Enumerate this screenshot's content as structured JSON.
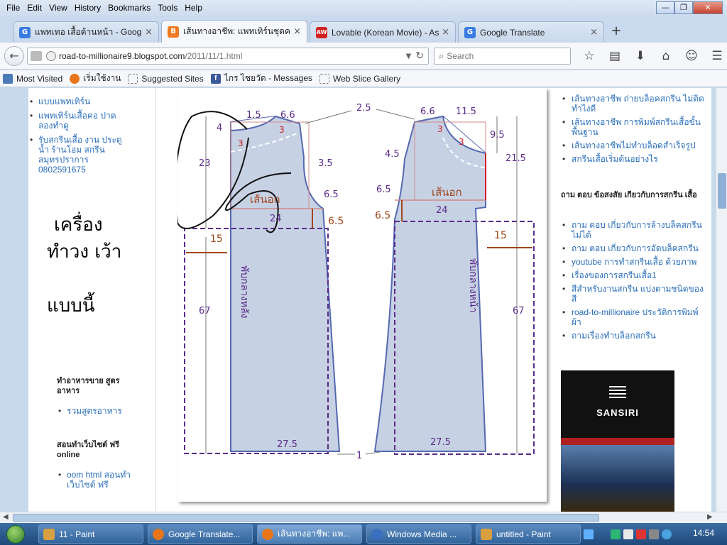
{
  "menu": [
    "File",
    "Edit",
    "View",
    "History",
    "Bookmarks",
    "Tools",
    "Help"
  ],
  "window_controls": {
    "minimize": "—",
    "restore": "❐",
    "close": "✕"
  },
  "tabs": [
    {
      "title": "แพทเทอ เสื้อด้านหน้า - Googl...",
      "favicon": "G",
      "color": "#3a7be0",
      "active": false
    },
    {
      "title": "เส้นทางอาชีพ: แพทเทิร์นชุดคลุ...",
      "favicon": "B",
      "color": "#f07a22",
      "active": true
    },
    {
      "title": "Lovable (Korean Movie) - Asia...",
      "favicon": "AW",
      "color": "#d02020",
      "active": false
    },
    {
      "title": "Google Translate",
      "favicon": "G",
      "color": "#3a7be0",
      "active": false
    }
  ],
  "tab_close": "×",
  "newtab_label": "+",
  "nav": {
    "back": "←",
    "url_host": "road-to-millionaire9.blogspot.com",
    "url_path": "/2011/11/1.html",
    "search_placeholder": "Search",
    "search_icon": "⌕",
    "icons": [
      "☆",
      "▤",
      "⬇",
      "⌂",
      "☺",
      "☰"
    ]
  },
  "bookmarks": [
    {
      "label": "Most Visited",
      "color": "#4a7ab8"
    },
    {
      "label": "เริ่มใช้งาน",
      "color": "#e8751a"
    },
    {
      "label": "Suggested Sites",
      "color": "#ffffff"
    },
    {
      "label": "ไกร ไชยวัด - Messages",
      "color": "#3b5998"
    },
    {
      "label": "Web Slice Gallery",
      "color": "#ffffff"
    }
  ],
  "left_links": [
    "แบบแพทเทิร์น",
    "แพทเทิร์นเสื้อคอ ปาดลองทำดู",
    "รับสกรีนเสื้อ งาน ประตูน้ำ ร้านโอม สกรีน สมุทรปราการ 0802591675"
  ],
  "big_text": [
    "เครื่อง",
    "ทำวง เว้า",
    "แบบนี้"
  ],
  "left_section1": {
    "heading": "ทำอาหารขาย สูตร อาหาร",
    "links": [
      "รวมสูตรอาหาร"
    ]
  },
  "left_section2": {
    "heading": "สอนทำเว็บไซต์ ฟรี online",
    "links": [
      "oom html สอนทำ เว็บไซต์ ฟรี"
    ]
  },
  "right_links_top": [
    "เส้นทางอาชีพ ถ่ายบล็อคสกรีน ไม่ติด ทำไงดี",
    "เส้นทางอาชีพ การพิมพ์สกรีนเสื้อขั้น พื้นฐาน",
    "เส้นทางอาชีพไม่ทำบล็อคสำเร็จรูป",
    "สกรีนเสื้อเริ่มต้นอย่างไร"
  ],
  "right_heading": "ถาม ตอบ ข้อสงสัย เกียวกับการสกรีน เสื้อ",
  "right_links_bottom": [
    "ถาม ตอบ เกี่ยวกับการล้างบล็คสกรีน ไม่ได้",
    "ถาม ตอบ เกี่ยวกับการอัดบล็คสกรีน",
    "youtube การทำสกรีนเสื้อ ด้วยภาพ",
    "เรื่องของการสกรีนเสื้อ1",
    "สีสำหรับงานสกรีน แบ่งตามชนิดของ สี",
    "road-to-millionaire ประวัติการพิมพ์ ผ้า",
    "ถามเรื่องทำบล็อกสกรีน"
  ],
  "ad": {
    "brand": "SANSIRI"
  },
  "pattern": {
    "left_labels": {
      "top_a": "1.5",
      "top_b": "6.6",
      "side_4": "4",
      "dart_3a": "3",
      "dart_3b": "3",
      "height_23": "23",
      "curve_35": "3.5",
      "curve_65": "6.5",
      "chest": "เส้นอก",
      "width_24": "24",
      "drop_65": "6.5",
      "side_15": "15",
      "length_67": "67",
      "hem": "27.5",
      "fold": "พับกลางหลัง"
    },
    "right_labels": {
      "top_a": "6.6",
      "top_b": "11.5",
      "height_95": "9.5",
      "height_215": "21.5",
      "dart_3a": "3",
      "dart_3b": "3",
      "curve_45": "4.5",
      "curve_65": "6.5",
      "chest": "เส้นอก",
      "width_24": "24",
      "drop_65": "6.5",
      "side_15": "15",
      "length_67": "67",
      "hem": "27.5",
      "fold": "พับกลางหน้า"
    },
    "shared": {
      "shoulder_25": "2.5",
      "hem_gap": "1"
    }
  },
  "taskbar": [
    {
      "label": "11 - Paint",
      "color": "#d8a040",
      "active": false
    },
    {
      "label": "Google Translate...",
      "color": "#e8751a",
      "active": false
    },
    {
      "label": "เส้นทางอาชีพ: แพ...",
      "color": "#e8751a",
      "active": true
    },
    {
      "label": "Windows Media ...",
      "color": "#3a70c0",
      "active": false
    },
    {
      "label": "untitled - Paint",
      "color": "#d8a040",
      "active": false
    }
  ],
  "tray_colors": [
    "#5fb0ff",
    "#2bb673",
    "#e8e8e8",
    "#d33",
    "#888",
    "#4aa3df",
    "#999"
  ],
  "clock": "14:54"
}
